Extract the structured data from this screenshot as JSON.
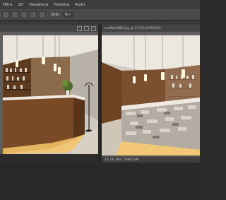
{
  "menu": [
    "Filtro",
    "3D",
    "Visualizza",
    "Finestra",
    "Aiuto"
  ],
  "options": {
    "style_label": "Stile:",
    "style_value": "Nor"
  },
  "left_window": {
    "title": "",
    "status": ""
  },
  "right_window": {
    "title": "scaffale086.jpg @ 13,5% (CMYK/8)",
    "status": "13,5%    Doc: 52M/52M"
  },
  "colors": {
    "wood": "#7a4a26",
    "ceiling": "#e9e4dc",
    "glow": "#f7c76a",
    "stone": "#b3aca3"
  }
}
